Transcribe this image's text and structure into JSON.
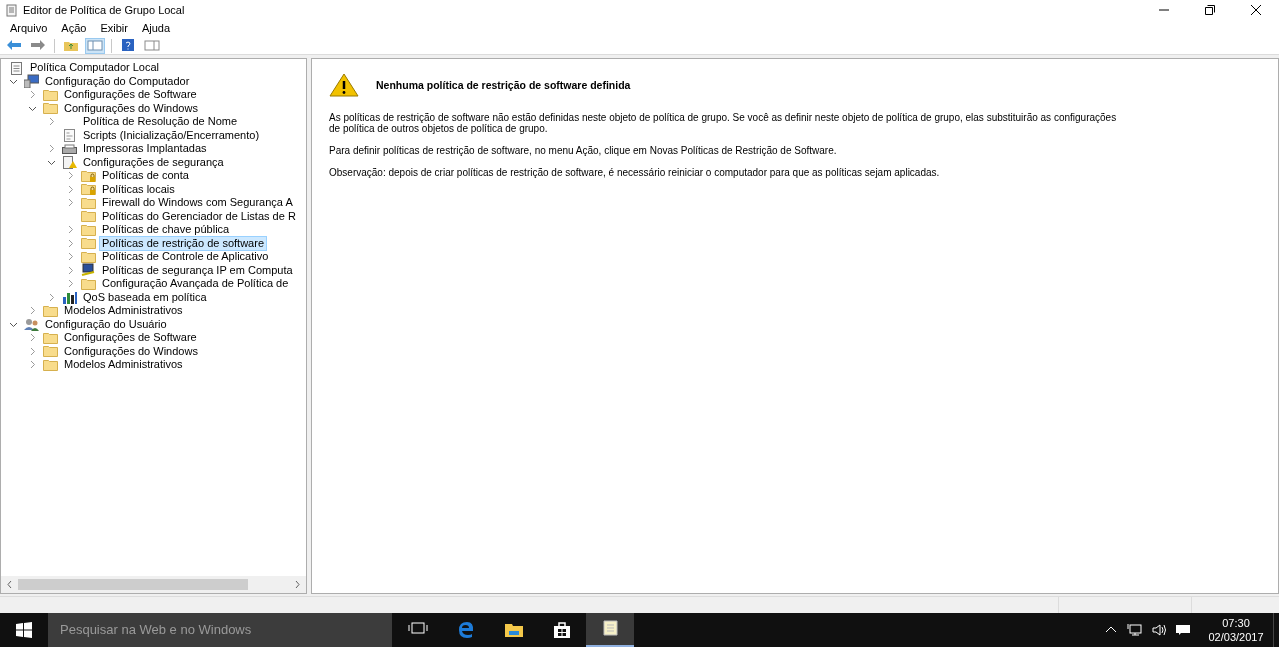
{
  "window": {
    "title": "Editor de Política de Grupo Local"
  },
  "menu": [
    "Arquivo",
    "Ação",
    "Exibir",
    "Ajuda"
  ],
  "toolbar": [
    {
      "kind": "back"
    },
    {
      "kind": "forward"
    },
    {
      "kind": "sep"
    },
    {
      "kind": "up"
    },
    {
      "kind": "pane",
      "selected": true
    },
    {
      "kind": "sep"
    },
    {
      "kind": "help"
    },
    {
      "kind": "view"
    }
  ],
  "tree": [
    {
      "label": "Política Computador Local",
      "kind": "doc",
      "selected": false,
      "children": [
        {
          "label": "Configuração do Computador",
          "kind": "computer",
          "expanded": true,
          "selected": false,
          "children": [
            {
              "label": "Configurações de Software",
              "kind": "folder",
              "expanded": false,
              "selected": false
            },
            {
              "label": "Configurações do Windows",
              "kind": "folder",
              "expanded": true,
              "selected": false,
              "children": [
                {
                  "label": "Política de Resolução de Nome",
                  "kind": "none",
                  "expanded": false,
                  "selected": false
                },
                {
                  "label": "Scripts (Inicialização/Encerramento)",
                  "kind": "script",
                  "selected": false
                },
                {
                  "label": "Impressoras Implantadas",
                  "kind": "printer",
                  "expanded": false,
                  "selected": false
                },
                {
                  "label": "Configurações de segurança",
                  "kind": "security",
                  "expanded": true,
                  "selected": false,
                  "children": [
                    {
                      "label": "Políticas de conta",
                      "kind": "folder-lock",
                      "expanded": false,
                      "selected": false
                    },
                    {
                      "label": "Políticas locais",
                      "kind": "folder-lock",
                      "expanded": false,
                      "selected": false
                    },
                    {
                      "label": "Firewall do Windows com Segurança A",
                      "kind": "folder",
                      "expanded": false,
                      "selected": false
                    },
                    {
                      "label": "Políticas do Gerenciador de Listas de R",
                      "kind": "folder",
                      "selected": false
                    },
                    {
                      "label": "Políticas de chave pública",
                      "kind": "folder",
                      "expanded": false,
                      "selected": false
                    },
                    {
                      "label": "Políticas de restrição de software",
                      "kind": "folder",
                      "expanded": false,
                      "selected": true
                    },
                    {
                      "label": "Políticas de Controle de Aplicativo",
                      "kind": "folder",
                      "expanded": false,
                      "selected": false
                    },
                    {
                      "label": "Políticas de segurança IP em Computa",
                      "kind": "network",
                      "expanded": false,
                      "selected": false
                    },
                    {
                      "label": "Configuração Avançada de Política de",
                      "kind": "folder",
                      "expanded": false,
                      "selected": false
                    }
                  ]
                },
                {
                  "label": "QoS baseada em política",
                  "kind": "chart",
                  "expanded": false,
                  "selected": false
                }
              ]
            },
            {
              "label": "Modelos Administrativos",
              "kind": "folder",
              "expanded": false,
              "selected": false
            }
          ]
        },
        {
          "label": "Configuração do Usuário",
          "kind": "user",
          "expanded": true,
          "selected": false,
          "children": [
            {
              "label": "Configurações de Software",
              "kind": "folder",
              "expanded": false,
              "selected": false
            },
            {
              "label": "Configurações do Windows",
              "kind": "folder",
              "expanded": false,
              "selected": false
            },
            {
              "label": "Modelos Administrativos",
              "kind": "folder",
              "expanded": false,
              "selected": false
            }
          ]
        }
      ]
    }
  ],
  "details": {
    "heading": "Nenhuma política de restrição de software definida",
    "paragraphs": [
      "As políticas de restrição de software não estão definidas neste objeto de política de grupo. Se você as definir neste objeto de política de grupo, elas substituirão as configurações de política de outros objetos de política de grupo.",
      "Para definir políticas de restrição de software, no menu Ação, clique em Novas Políticas de Restrição de Software.",
      "Observação: depois de criar políticas de restrição de software, é necessário reiniciar o computador para que as políticas sejam aplicadas."
    ]
  },
  "taskbar": {
    "search_placeholder": "Pesquisar na Web e no Windows",
    "apps": [
      {
        "kind": "taskview",
        "selected": false
      },
      {
        "kind": "edge",
        "selected": false
      },
      {
        "kind": "explorer",
        "selected": false
      },
      {
        "kind": "store",
        "selected": false
      },
      {
        "kind": "gpedit",
        "selected": true
      }
    ],
    "time": "07:30",
    "date": "02/03/2017"
  }
}
